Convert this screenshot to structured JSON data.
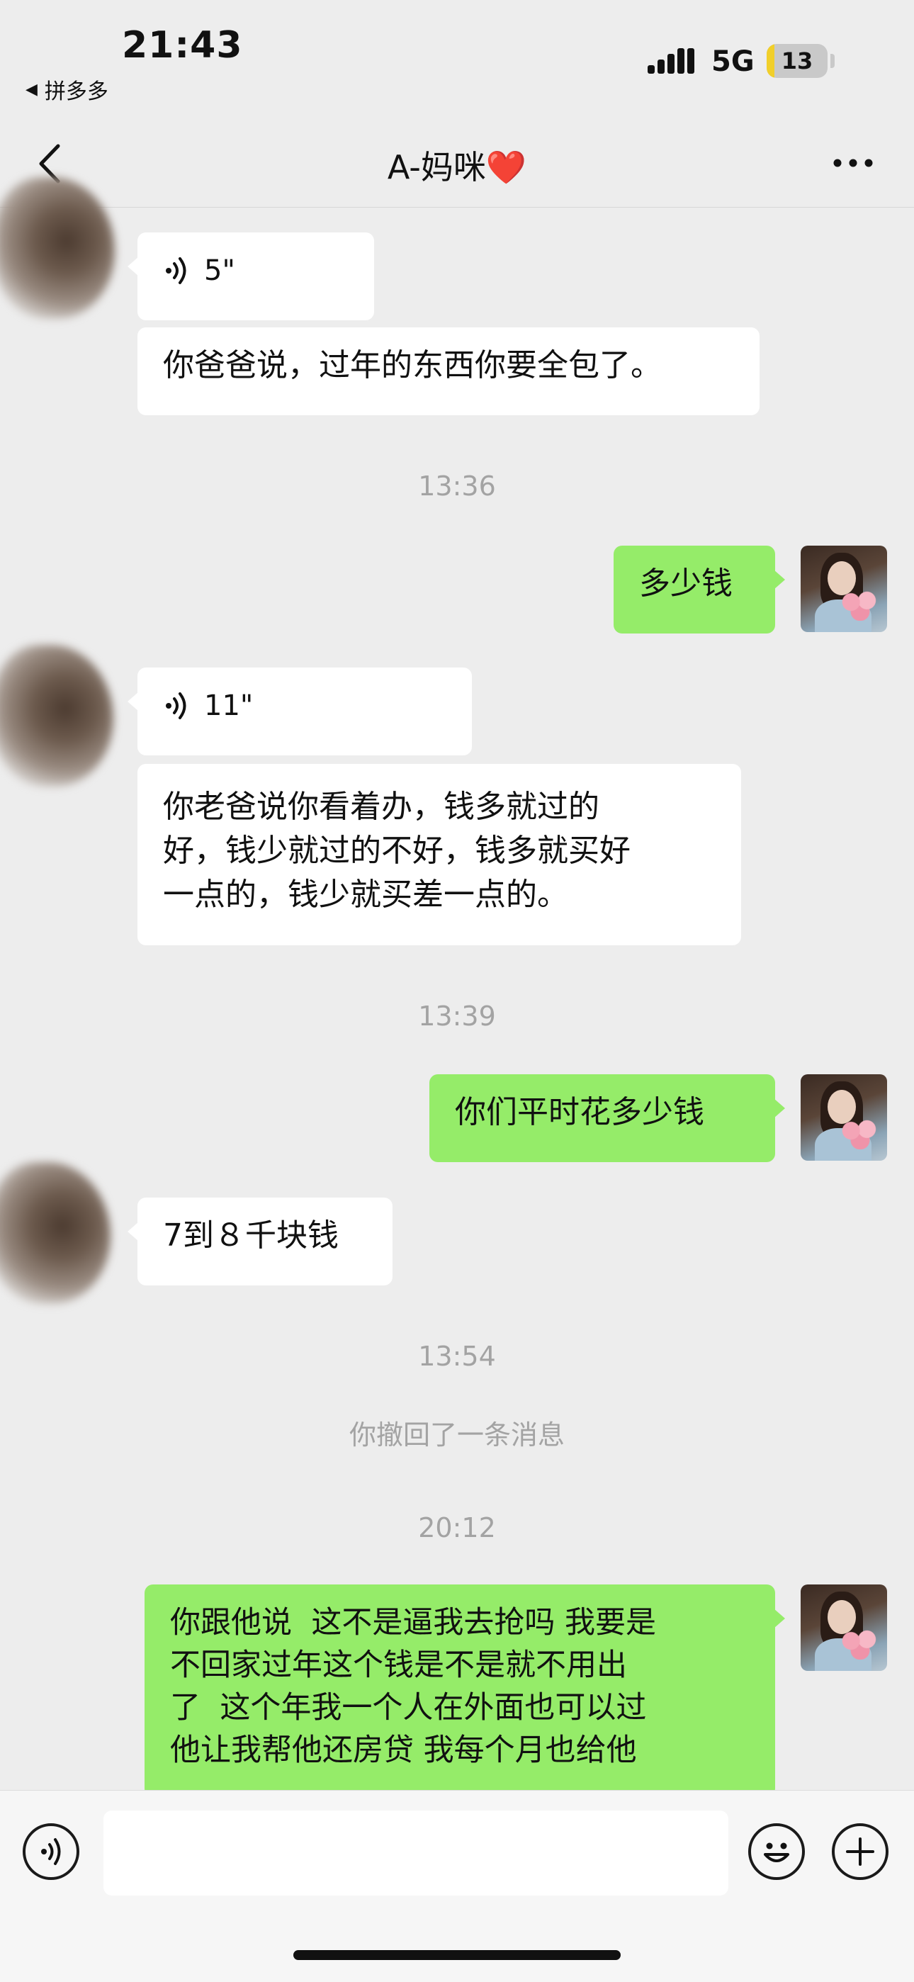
{
  "status_bar": {
    "time": "21:43",
    "back_app": "拼多多",
    "network": "5G",
    "battery": "13",
    "battery_level_percent": 13
  },
  "nav": {
    "title": "A-妈咪",
    "title_emoji": "❤️",
    "back_icon": "chevron-left-icon",
    "more_icon": "more-dots-icon"
  },
  "messages": [
    {
      "type": "voice",
      "side": "left",
      "duration": "5\""
    },
    {
      "type": "text",
      "side": "left",
      "text": "你爸爸说，过年的东西你要全包了。"
    },
    {
      "type": "time",
      "text": "13:36"
    },
    {
      "type": "text",
      "side": "right",
      "text": "多少钱"
    },
    {
      "type": "voice",
      "side": "left",
      "duration": "11\""
    },
    {
      "type": "text",
      "side": "left",
      "lines": [
        "你老爸说你看着办，钱多就过的",
        "好，钱少就过的不好，钱多就买好",
        "一点的，钱少就买差一点的。"
      ]
    },
    {
      "type": "time",
      "text": "13:39"
    },
    {
      "type": "text",
      "side": "right",
      "text": "你们平时花多少钱"
    },
    {
      "type": "text",
      "side": "left",
      "text": "7到８千块钱"
    },
    {
      "type": "time",
      "text": "13:54"
    },
    {
      "type": "system",
      "text": "你撤回了一条消息"
    },
    {
      "type": "time",
      "text": "20:12"
    },
    {
      "type": "text",
      "side": "right",
      "lines": [
        "你跟他说  这不是逼我去抢吗 我要是",
        "不回家过年这个钱是不是就不用出",
        "了  这个年我一个人在外面也可以过",
        "他让我帮他还房贷 我每个月也给他"
      ]
    }
  ],
  "input_bar": {
    "voice_icon": "voice-input-icon",
    "emoji_icon": "emoji-icon",
    "plus_icon": "plus-icon",
    "placeholder": ""
  },
  "colors": {
    "background": "#ededed",
    "my_bubble": "#95ec69",
    "their_bubble": "#ffffff",
    "timestamp": "#a3a3a3",
    "battery_fill": "#f1cf2a"
  }
}
